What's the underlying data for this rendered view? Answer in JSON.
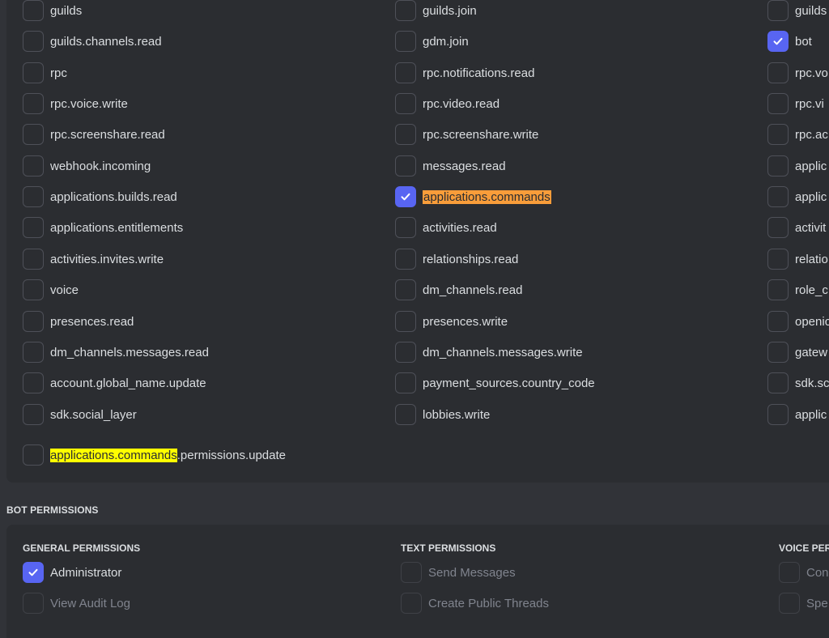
{
  "scopes": {
    "col1": [
      {
        "label": "guilds",
        "checked": false
      },
      {
        "label": "guilds.channels.read",
        "checked": false
      },
      {
        "label": "rpc",
        "checked": false
      },
      {
        "label": "rpc.voice.write",
        "checked": false
      },
      {
        "label": "rpc.screenshare.read",
        "checked": false
      },
      {
        "label": "webhook.incoming",
        "checked": false
      },
      {
        "label": "applications.builds.read",
        "checked": false
      },
      {
        "label": "applications.entitlements",
        "checked": false
      },
      {
        "label": "activities.invites.write",
        "checked": false
      },
      {
        "label": "voice",
        "checked": false
      },
      {
        "label": "presences.read",
        "checked": false
      },
      {
        "label": "dm_channels.messages.read",
        "checked": false
      },
      {
        "label": "account.global_name.update",
        "checked": false
      },
      {
        "label": "sdk.social_layer",
        "checked": false
      }
    ],
    "col2": [
      {
        "label": "guilds.join",
        "checked": false
      },
      {
        "label": "gdm.join",
        "checked": false
      },
      {
        "label": "rpc.notifications.read",
        "checked": false
      },
      {
        "label": "rpc.video.read",
        "checked": false
      },
      {
        "label": "rpc.screenshare.write",
        "checked": false
      },
      {
        "label": "messages.read",
        "checked": false
      },
      {
        "label": "applications.commands",
        "checked": true
      },
      {
        "label": "activities.read",
        "checked": false
      },
      {
        "label": "relationships.read",
        "checked": false
      },
      {
        "label": "dm_channels.read",
        "checked": false
      },
      {
        "label": "presences.write",
        "checked": false
      },
      {
        "label": "dm_channels.messages.write",
        "checked": false
      },
      {
        "label": "payment_sources.country_code",
        "checked": false
      },
      {
        "label": "lobbies.write",
        "checked": false
      }
    ],
    "col3": [
      {
        "label": "guilds",
        "checked": false
      },
      {
        "label": "bot",
        "checked": true
      },
      {
        "label": "rpc.vo",
        "checked": false
      },
      {
        "label": "rpc.vi",
        "checked": false
      },
      {
        "label": "rpc.ac",
        "checked": false
      },
      {
        "label": "applic",
        "checked": false
      },
      {
        "label": "applic",
        "checked": false
      },
      {
        "label": "activit",
        "checked": false
      },
      {
        "label": "relatio",
        "checked": false
      },
      {
        "label": "role_c",
        "checked": false
      },
      {
        "label": "openic",
        "checked": false
      },
      {
        "label": "gatew",
        "checked": false
      },
      {
        "label": "sdk.sc",
        "checked": false
      },
      {
        "label": "applic",
        "checked": false
      }
    ],
    "extra": {
      "highlight_part": "applications.commands",
      "rest_part": ".permissions.update",
      "checked": false
    }
  },
  "bot_permissions": {
    "title": "BOT PERMISSIONS",
    "general": {
      "header": "GENERAL PERMISSIONS",
      "items": [
        {
          "label": "Administrator",
          "checked": true,
          "disabled": false
        },
        {
          "label": "View Audit Log",
          "checked": false,
          "disabled": true
        }
      ]
    },
    "text": {
      "header": "TEXT PERMISSIONS",
      "items": [
        {
          "label": "Send Messages",
          "checked": false,
          "disabled": true
        },
        {
          "label": "Create Public Threads",
          "checked": false,
          "disabled": true
        }
      ]
    },
    "voice": {
      "header": "VOICE PER",
      "items": [
        {
          "label": "Con",
          "checked": false,
          "disabled": true
        },
        {
          "label": "Spe",
          "checked": false,
          "disabled": true
        }
      ]
    }
  },
  "colors": {
    "checkbox_checked": "#5865f2",
    "highlight_orange": "#f99d3a",
    "highlight_yellow": "#ffff00"
  },
  "icons": {
    "check": "checkmark-icon"
  }
}
